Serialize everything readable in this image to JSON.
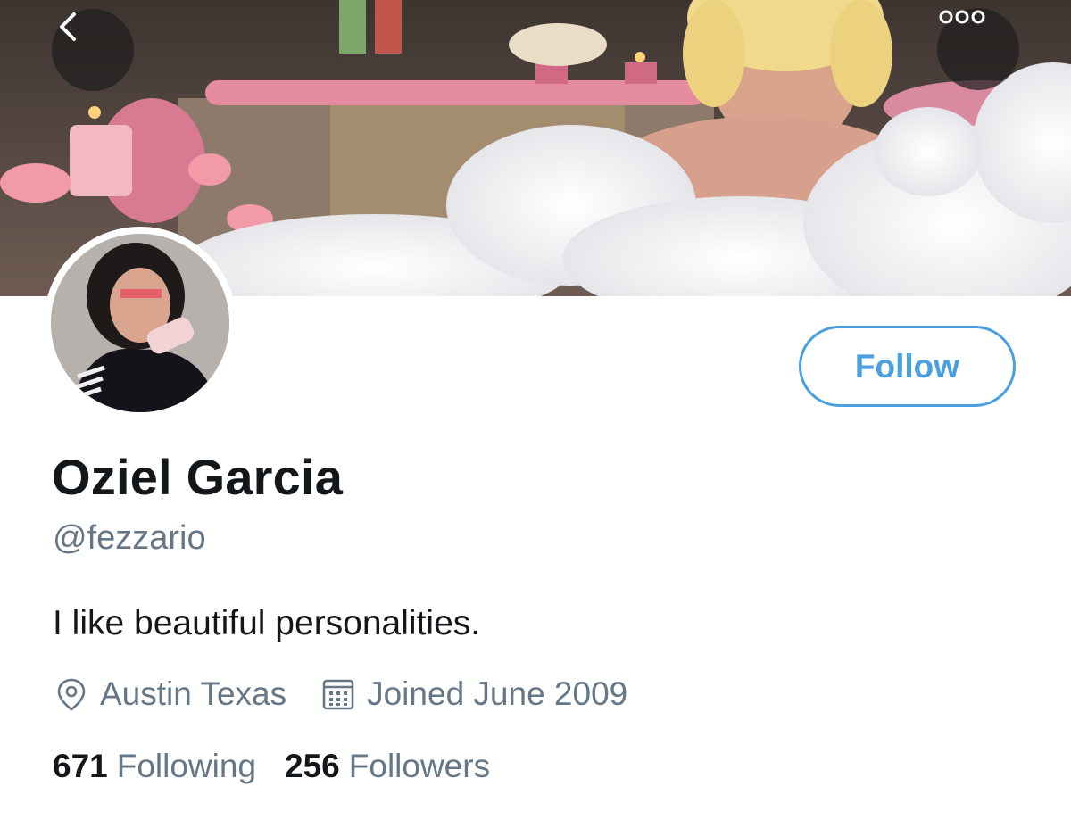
{
  "profile": {
    "name": "Oziel Garcia",
    "handle": "@fezzario",
    "bio": "I like beautiful personalities.",
    "location": "Austin Texas",
    "joined": "Joined June 2009",
    "following_count": "671",
    "following_label": "Following",
    "followers_count": "256",
    "followers_label": "Followers"
  },
  "actions": {
    "follow_label": "Follow"
  },
  "icons": {
    "back": "chevron-left-icon",
    "more": "more-icon",
    "location": "location-pin-icon",
    "calendar": "calendar-icon"
  },
  "colors": {
    "accent": "#4a9fe0",
    "secondary_text": "#657786",
    "primary_text": "#14171a"
  }
}
